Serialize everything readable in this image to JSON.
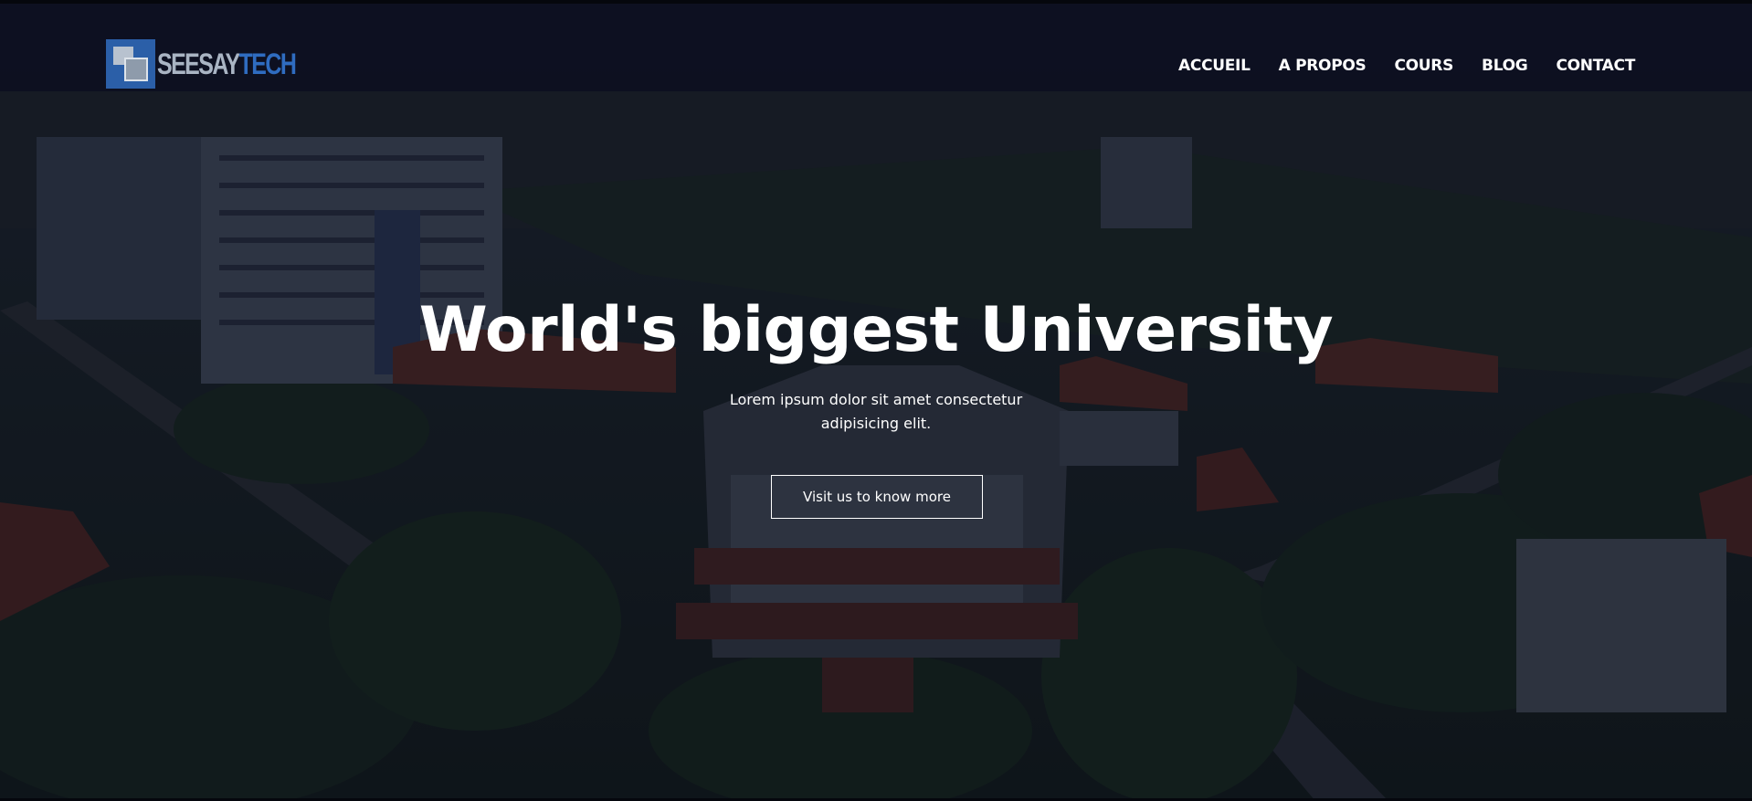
{
  "brand": {
    "logo_part1": "SEESAY",
    "logo_part2": "TECH",
    "logo_icon": "stacked-squares-logo"
  },
  "nav": {
    "items": [
      {
        "label": "ACCUEIL"
      },
      {
        "label": "A PROPOS"
      },
      {
        "label": "COURS"
      },
      {
        "label": "BLOG"
      },
      {
        "label": "CONTACT"
      }
    ]
  },
  "hero": {
    "title": "World's biggest University",
    "subtitle": "Lorem ipsum dolor sit amet consectetur adipisicing elit.",
    "cta_label": "Visit us to know more",
    "background": "aerial-campus-photo"
  },
  "colors": {
    "overlay": "#0c1020",
    "logo_blue": "#2f6cc0",
    "logo_grey": "#a9b4c3",
    "text": "#ffffff"
  }
}
